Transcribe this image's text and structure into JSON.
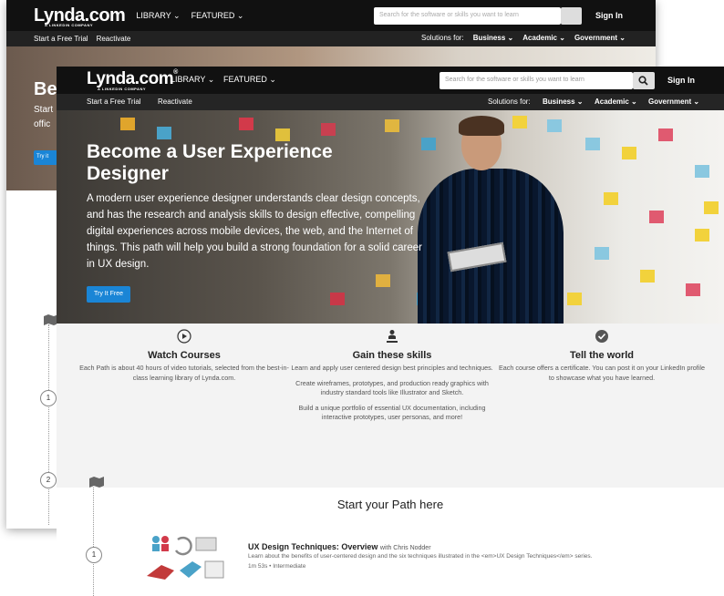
{
  "back": {
    "logo": "Lynda.com",
    "logo_tag": "A LINKEDIN COMPANY",
    "nav": {
      "library": "LIBRARY ⌄",
      "featured": "FEATURED ⌄"
    },
    "search_placeholder": "Search for the software or skills you want to learn",
    "signin": "Sign In",
    "sub": {
      "trial": "Start a Free Trial",
      "reactivate": "Reactivate",
      "solutions": "Solutions for:",
      "business": "Business ⌄",
      "academic": "Academic ⌄",
      "government": "Government ⌄"
    },
    "hero_title": "Be",
    "hero_text_1": "Start",
    "hero_text_2": "offic",
    "hero_btn": "Try it",
    "steps": [
      "1",
      "2"
    ]
  },
  "front": {
    "logo": "Lynda.com",
    "logo_reg": "®",
    "logo_tag": "A LINKEDIN COMPANY",
    "nav": {
      "library": "LIBRARY ⌄",
      "featured": "FEATURED ⌄"
    },
    "search_placeholder": "Search for the software or skills you want to learn",
    "signin": "Sign In",
    "sub": {
      "trial": "Start a Free Trial",
      "reactivate": "Reactivate",
      "solutions": "Solutions for:",
      "business": "Business ⌄",
      "academic": "Academic ⌄",
      "government": "Government ⌄"
    },
    "hero": {
      "title": "Become a User Experience Designer",
      "text": "A modern user experience designer understands clear design concepts, and has the research and analysis skills to design effective, compelling digital experiences across mobile devices, the web, and the Internet of things. This path will help you build a strong foundation for a solid career in UX design.",
      "button": "Try It Free"
    },
    "features": [
      {
        "icon": "play-icon",
        "title": "Watch Courses",
        "paras": [
          "Each Path is about 40 hours of video tutorials, selected from the best-in-class learning library of Lynda.com."
        ]
      },
      {
        "icon": "presenter-icon",
        "title": "Gain these skills",
        "paras": [
          "Learn and apply user centered design best principles and techniques.",
          "Create wireframes, prototypes, and production ready graphics with industry standard tools like Illustrator and Sketch.",
          "Build a unique portfolio of essential UX documentation, including interactive prototypes, user personas, and more!"
        ]
      },
      {
        "icon": "certificate-icon",
        "title": "Tell the world",
        "paras": [
          "Each course offers a certificate. You can post it on your LinkedIn profile to showcase what you have learned."
        ]
      }
    ],
    "path": {
      "title": "Start your Path here",
      "step": "1",
      "course": {
        "title": "UX Design Techniques: Overview",
        "author": "with Chris Nodder",
        "description": "Learn about the benefits of user-centered design and the six techniques illustrated in the <em>UX Design Techniques</em> series.",
        "meta": "1m 53s • Intermediate"
      }
    }
  },
  "colors": {
    "accent": "#1a85d6",
    "navbar": "#111111",
    "subbar": "#252525"
  }
}
